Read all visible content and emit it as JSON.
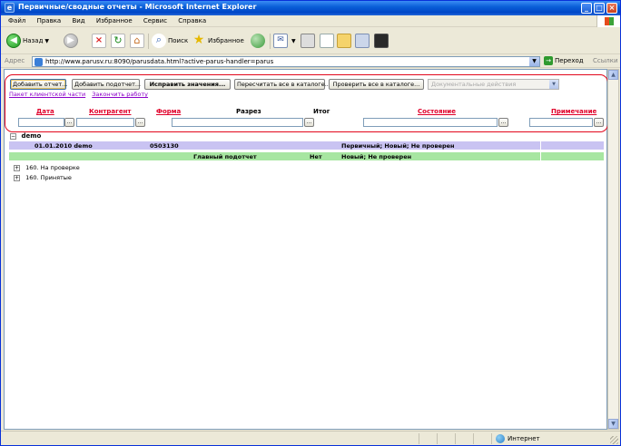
{
  "window": {
    "title": "Первичные/сводные отчеты - Microsoft Internet Explorer"
  },
  "menu": [
    "Файл",
    "Правка",
    "Вид",
    "Избранное",
    "Сервис",
    "Справка"
  ],
  "toolbar": {
    "back": "Назад",
    "search": "Поиск",
    "favorites": "Избранное"
  },
  "address": {
    "label": "Адрес",
    "url": "http://www.parusv.ru:8090/parusdata.html?active-parus-handler=parus",
    "go": "Переход",
    "links": "Ссылки"
  },
  "actions": {
    "add_report": "Добавить отчет...",
    "add_subreport": "Добавить подотчет...",
    "fix_values": "Исправить значения...",
    "recalc_all": "Пересчитать все в каталоге...",
    "check_all": "Проверить все в каталоге...",
    "doc_actions_placeholder": "Документальные действия"
  },
  "links": {
    "client_package": "Пакет клиентской части",
    "finish_work": "Закончить работу"
  },
  "columns": {
    "date": "Дата",
    "counterparty": "Контрагент",
    "form": "Форма",
    "section": "Разрез",
    "total": "Итог",
    "state": "Состояние",
    "note": "Примечание"
  },
  "filter_button": "...",
  "group": {
    "toggle": "−",
    "name": "demo"
  },
  "rows": [
    {
      "date_cp": "01.01.2010 demo",
      "form": "0503130",
      "section": "",
      "total": "",
      "state": "Первичный; Новый; Не проверен",
      "note": ""
    },
    {
      "date_cp": "",
      "form": "",
      "section": "Главный подотчет",
      "total": "Нет",
      "state": "Новый; Не проверен",
      "note": ""
    }
  ],
  "tree": [
    {
      "toggle": "+",
      "label": "160. На проверке"
    },
    {
      "toggle": "+",
      "label": "160. Принятые"
    }
  ],
  "status": {
    "zone": "Интернет"
  }
}
